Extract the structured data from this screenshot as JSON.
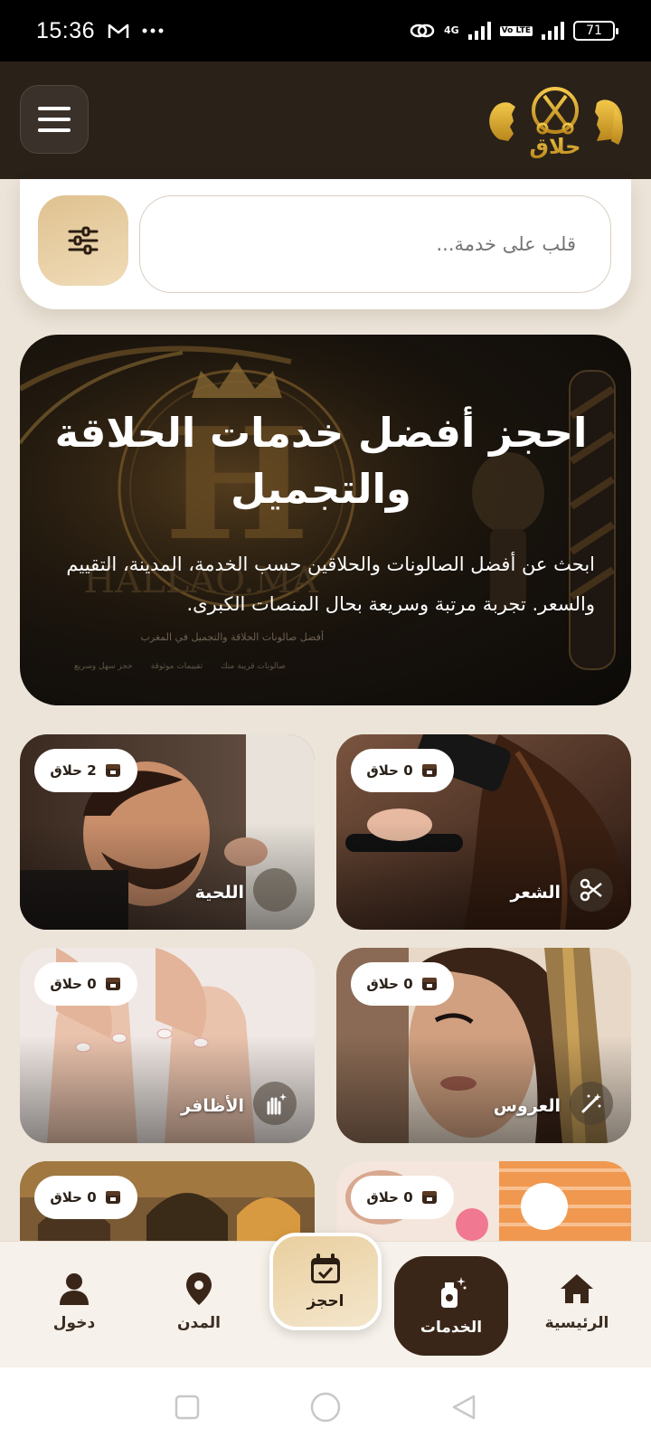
{
  "status_bar": {
    "time": "15:36",
    "notification_icons": [
      "gmail-icon",
      "more-dots-icon"
    ],
    "network": "4G",
    "volte": "Vo LTE",
    "battery": "71"
  },
  "header": {
    "logo_text": "حلاق",
    "menu_icon": "hamburger-menu-icon"
  },
  "search": {
    "placeholder": "قلب على خدمة...",
    "filter_icon": "sliders-icon"
  },
  "hero": {
    "title": "احجز أفضل خدمات الحلاقة والتجميل",
    "subtitle": "ابحث عن أفضل الصالونات والحلاقين حسب الخدمة، المدينة، التقييم والسعر. تجربة مرتبة وسريعة بحال المنصات الكبرى.",
    "bg_caption": "أفضل صالونات الحلاقة والتجميل في المغرب",
    "bg_features": [
      "صالونات قريبة منك",
      "تقييمات موثوقة",
      "حجز سهل وسريع"
    ],
    "bg_brand": "HALLAQ.MA"
  },
  "services": [
    {
      "label": "الشعر",
      "count": "0 حلاق",
      "icon": "scissors-icon"
    },
    {
      "label": "اللحية",
      "count": "2 حلاق",
      "icon": "razor-icon"
    },
    {
      "label": "العروس",
      "count": "0 حلاق",
      "icon": "magic-wand-icon"
    },
    {
      "label": "الأظافر",
      "count": "0 حلاق",
      "icon": "hand-sparkle-icon"
    },
    {
      "label": "",
      "count": "0 حلاق",
      "icon": "spa-icon"
    },
    {
      "label": "",
      "count": "0 حلاق",
      "icon": "steam-icon"
    }
  ],
  "bottom_nav": {
    "home": "الرئيسية",
    "services": "الخدمات",
    "book": "احجز",
    "cities": "المدن",
    "login": "دخول"
  },
  "colors": {
    "header_bg": "#2a2119",
    "accent_gold": "#dfc18f",
    "active_nav": "#3a2619",
    "page_bg": "#ece4d8"
  }
}
